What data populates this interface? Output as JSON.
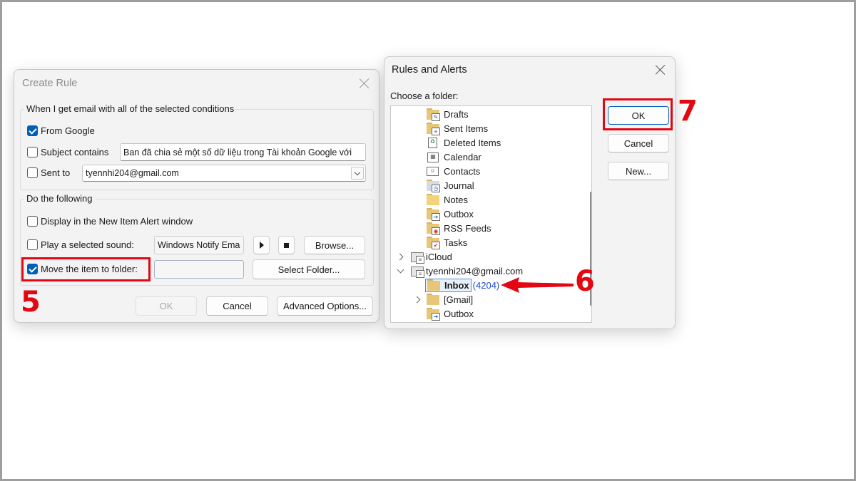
{
  "create_rule": {
    "title": "Create Rule",
    "conditions_group_label": "When I get email with all of the selected conditions",
    "from_label": "From Google",
    "from_checked": true,
    "subject_label": "Subject contains",
    "subject_checked": false,
    "subject_value": "Ban đã chia sẻ một số dữ liệu trong Tài khoản Google với",
    "sent_to_label": "Sent to",
    "sent_to_checked": false,
    "sent_to_value": "tyennhi204@gmail.com",
    "actions_group_label": "Do the following",
    "display_alert_label": "Display in the New Item Alert window",
    "display_alert_checked": false,
    "play_sound_label": "Play a selected sound:",
    "play_sound_checked": false,
    "sound_value": "Windows Notify Ema",
    "browse_label": "Browse...",
    "move_label": "Move the item to folder:",
    "move_checked": true,
    "move_folder_value": "",
    "select_folder_label": "Select Folder...",
    "ok_label": "OK",
    "cancel_label": "Cancel",
    "advanced_label": "Advanced Options..."
  },
  "rules_alerts": {
    "title": "Rules and Alerts",
    "choose_label": "Choose a folder:",
    "ok_label": "OK",
    "cancel_label": "Cancel",
    "new_label": "New...",
    "folders": [
      {
        "label": "Drafts",
        "icon": "drafts-folder-icon"
      },
      {
        "label": "Sent Items",
        "icon": "sent-items-folder-icon"
      },
      {
        "label": "Deleted Items",
        "icon": "deleted-items-folder-icon"
      },
      {
        "label": "Calendar",
        "icon": "calendar-folder-icon"
      },
      {
        "label": "Contacts",
        "icon": "contacts-folder-icon"
      },
      {
        "label": "Journal",
        "icon": "journal-folder-icon"
      },
      {
        "label": "Notes",
        "icon": "notes-folder-icon"
      },
      {
        "label": "Outbox",
        "icon": "outbox-folder-icon"
      },
      {
        "label": "RSS Feeds",
        "icon": "rss-feeds-folder-icon"
      },
      {
        "label": "Tasks",
        "icon": "tasks-folder-icon"
      }
    ],
    "accounts": [
      {
        "label": "iCloud",
        "expanded": false
      },
      {
        "label": "tyennhi204@gmail.com",
        "expanded": true
      }
    ],
    "gmail_children": [
      {
        "label": "Inbox",
        "count": "(4204)",
        "selected": true
      },
      {
        "label": "[Gmail]",
        "expandable": true
      },
      {
        "label": "Outbox"
      }
    ]
  },
  "annotations": {
    "step5": "5",
    "step6": "6",
    "step7": "7",
    "highlight_color": "#e30613"
  }
}
